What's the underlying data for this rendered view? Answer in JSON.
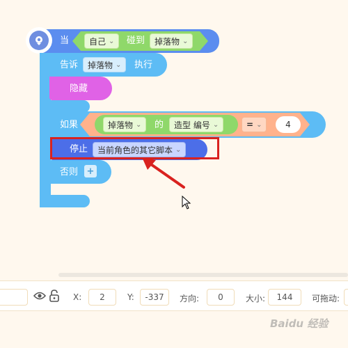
{
  "event_block": {
    "prefix": "当",
    "target": "自己",
    "verb": "碰到",
    "object": "掉落物"
  },
  "tell_block": {
    "prefix": "告诉",
    "target": "掉落物",
    "suffix": "执行"
  },
  "hide_block": {
    "label": "隐藏"
  },
  "if_block": {
    "label": "如果",
    "sprite": "掉落物",
    "of": "的",
    "property": "造型 编号",
    "operator": "=",
    "value": "4",
    "else_label": "否则",
    "add_symbol": "+"
  },
  "stop_block": {
    "label": "停止",
    "option": "当前角色的其它脚本"
  },
  "properties": {
    "x_label": "X:",
    "x_value": "2",
    "y_label": "Y:",
    "y_value": "-337",
    "direction_label": "方向:",
    "direction_value": "0",
    "size_label": "大小:",
    "size_value": "144",
    "draggable_label": "可拖动:"
  },
  "colors": {
    "event": "#5b8def",
    "control": "#5dbcf5",
    "looks": "#e062e6",
    "operator": "#ffb28c",
    "sensing": "#8fd86a",
    "stop": "#4c6ee8",
    "highlight": "#d9221f",
    "background": "#fff8ee"
  },
  "watermark": "Baidu 经验"
}
